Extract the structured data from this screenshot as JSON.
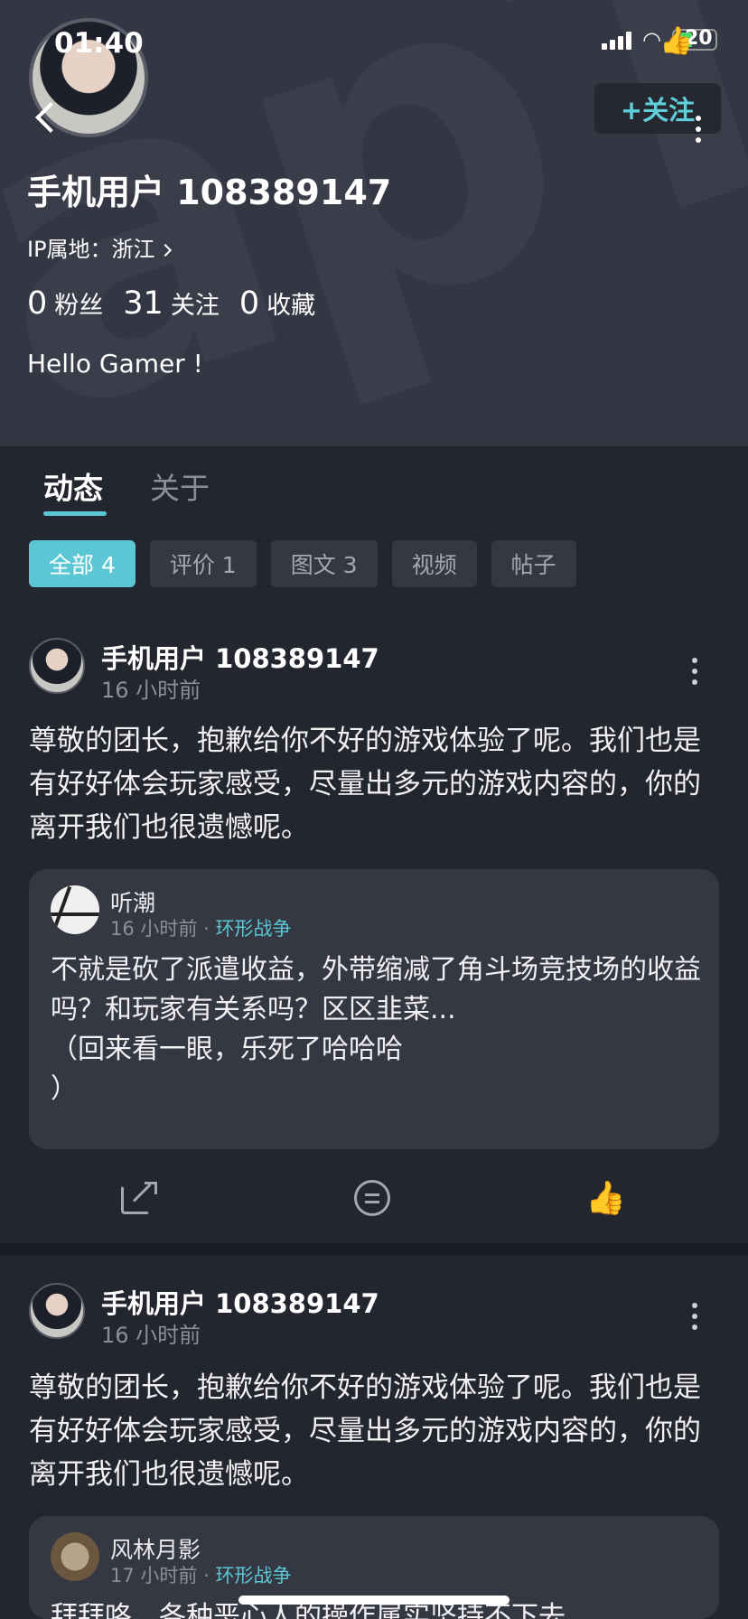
{
  "status_bar": {
    "time": "01:40",
    "battery": "20"
  },
  "profile": {
    "follow_label": "+关注",
    "username": "手机用户 108389147",
    "ip_location": "IP属地：浙江",
    "stats": [
      {
        "value": "0",
        "label": "粉丝"
      },
      {
        "value": "31",
        "label": "关注"
      },
      {
        "value": "0",
        "label": "收藏"
      }
    ],
    "bio": "Hello Gamer !"
  },
  "tabs": [
    {
      "label": "动态"
    },
    {
      "label": "关于"
    }
  ],
  "filters": [
    {
      "label": "全部 4"
    },
    {
      "label": "评价 1"
    },
    {
      "label": "图文 3"
    },
    {
      "label": "视频"
    },
    {
      "label": "帖子"
    }
  ],
  "posts": [
    {
      "user": "手机用户 108389147",
      "time": "16 小时前",
      "text": "尊敬的团长，抱歉给你不好的游戏体验了呢。我们也是有好好体会玩家感受，尽量出多元的游戏内容的，你的离开我们也很遗憾呢。",
      "quote": {
        "user": "听潮",
        "time": "16 小时前",
        "separator": "·",
        "game": "环形战争",
        "text": "不就是砍了派遣收益，外带缩减了角斗场竞技场的收益吗？和玩家有关系吗？区区韭菜...\n（回来看一眼，乐死了哈哈哈\n）"
      }
    },
    {
      "user": "手机用户 108389147",
      "time": "16 小时前",
      "text": "尊敬的团长，抱歉给你不好的游戏体验了呢。我们也是有好好体会玩家感受，尽量出多元的游戏内容的，你的离开我们也很遗憾呢。",
      "quote": {
        "user": "风林月影",
        "time": "17 小时前",
        "separator": "·",
        "game": "环形战争",
        "text": "拜拜咯，各种恶心人的操作属实坚持不下去"
      }
    }
  ],
  "icons": {
    "back": "chevron-left-icon",
    "more": "more-vertical-icon",
    "share": "share-icon",
    "comment": "comment-icon",
    "like": "thumbs-up-icon"
  },
  "colors": {
    "accent": "#5bc7d4",
    "header_bg": "#343743",
    "page_bg": "#23252f",
    "card_bg": "#353843"
  }
}
